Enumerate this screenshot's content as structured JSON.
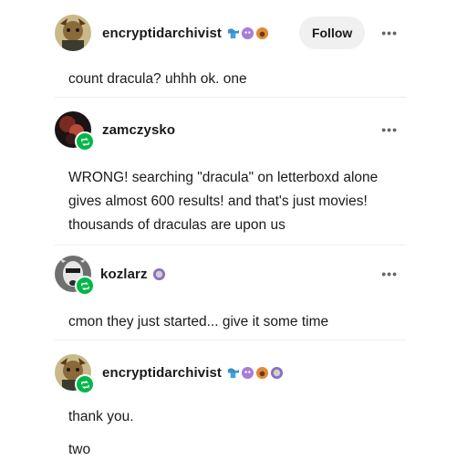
{
  "posts": [
    {
      "username": "encryptidarchivist",
      "follow_label": "Follow",
      "more": "•••",
      "paragraphs": [
        "count dracula? uhhh ok. one"
      ]
    },
    {
      "username": "zamczysko",
      "more": "•••",
      "paragraphs": [
        "WRONG! searching \"dracula\" on letterboxd alone gives almost 600 results! and that's just movies! thousands of draculas are upon us"
      ]
    },
    {
      "username": "kozlarz",
      "more": "•••",
      "paragraphs": [
        "cmon they just started... give it some time"
      ]
    },
    {
      "username": "encryptidarchivist",
      "more": "•••",
      "paragraphs": [
        "thank you.",
        "two"
      ]
    }
  ],
  "icons": {
    "reblog": "reblog-icon",
    "more": "ellipsis-icon",
    "badges": [
      "wave-badge",
      "purple-creature-badge",
      "orange-creature-badge",
      "grey-creature-badge"
    ]
  },
  "colors": {
    "reblog_green": "#00b84a",
    "follow_bg": "#f0f0f0",
    "divider": "#eeeeee"
  }
}
